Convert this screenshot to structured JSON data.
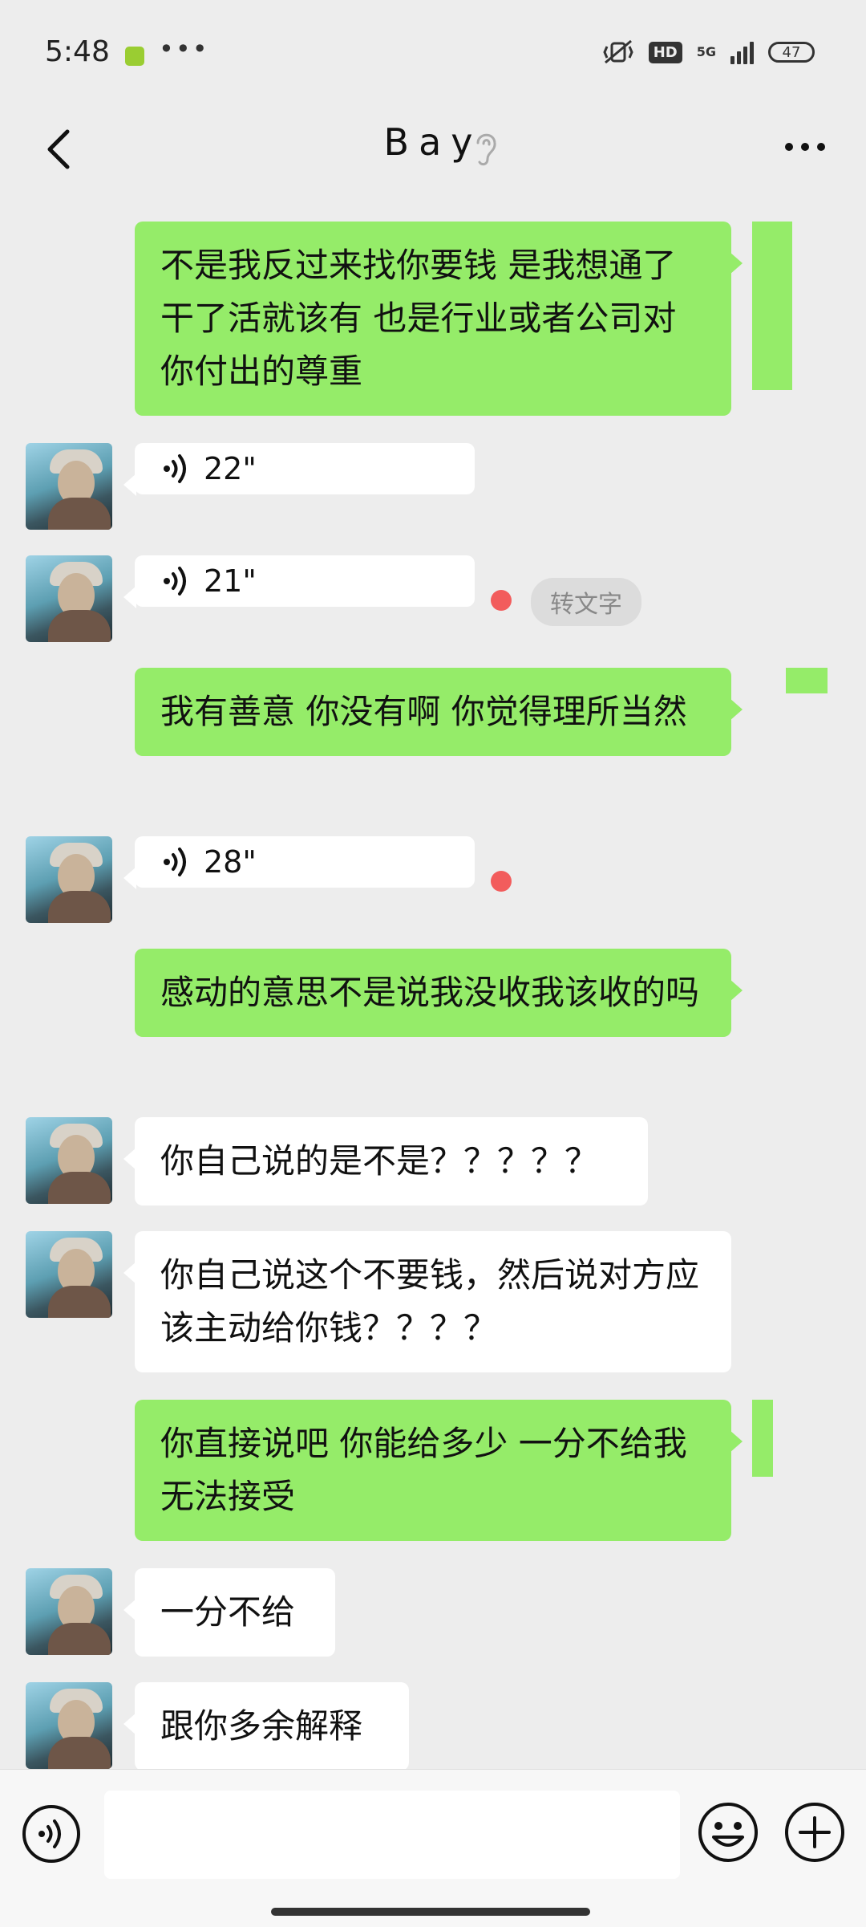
{
  "status_bar": {
    "time": "5:48",
    "hd": "HD",
    "network": "5G",
    "battery": "47"
  },
  "header": {
    "title": "Bay",
    "icons": [
      "back-icon",
      "ear-icon",
      "more-icon"
    ]
  },
  "messages": [
    {
      "side": "right",
      "type": "text",
      "text": "不是我反过来找你要钱 是我想通了干了活就该有 也是行业或者公司对你付出的尊重"
    },
    {
      "side": "left",
      "type": "voice",
      "duration": "22\""
    },
    {
      "side": "left",
      "type": "voice",
      "duration": "21\"",
      "unread": true,
      "action": "转文字"
    },
    {
      "side": "right",
      "type": "text",
      "text": "我有善意 你没有啊 你觉得理所当然"
    },
    {
      "side": "left",
      "type": "voice",
      "duration": "28\"",
      "unread": true
    },
    {
      "side": "right",
      "type": "text",
      "text": "感动的意思不是说我没收我该收的吗"
    },
    {
      "side": "left",
      "type": "text",
      "text": "你自己说的是不是？？？？？"
    },
    {
      "side": "left",
      "type": "text",
      "text": "你自己说这个不要钱，然后说对方应该主动给你钱？？？？"
    },
    {
      "side": "right",
      "type": "text",
      "text": "你直接说吧 你能给多少 一分不给我无法接受"
    },
    {
      "side": "left",
      "type": "text",
      "text": "一分不给"
    },
    {
      "side": "left",
      "type": "text",
      "text": "跟你多余解释"
    }
  ],
  "input_bar": {
    "input_value": "",
    "icons": [
      "voice-input-icon",
      "emoji-icon",
      "plus-icon"
    ]
  },
  "colors": {
    "background": "#ededed",
    "my_bubble": "#95ec69",
    "their_bubble": "#ffffff",
    "unread_dot": "#f25c5c"
  }
}
